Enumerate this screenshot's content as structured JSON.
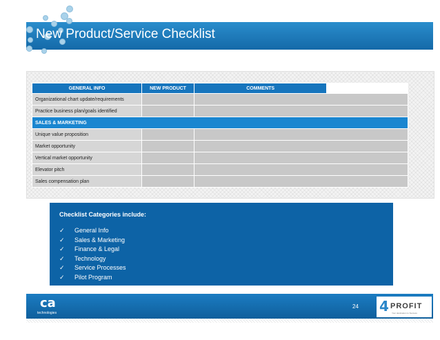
{
  "title": "New Product/Service Checklist",
  "table": {
    "headers": [
      "GENERAL INFO",
      "NEW PRODUCT",
      "COMMENTS"
    ],
    "rows": [
      {
        "type": "item",
        "label": "Organizational chart update/requirements"
      },
      {
        "type": "item",
        "label": "Practice business plan/goals identified"
      },
      {
        "type": "section",
        "label": "SALES & MARKETING"
      },
      {
        "type": "item",
        "label": "Unique value proposition"
      },
      {
        "type": "item",
        "label": "Market opportunity"
      },
      {
        "type": "item",
        "label": "Vertical market opportunity"
      },
      {
        "type": "item",
        "label": "Elevator pitch"
      },
      {
        "type": "item",
        "label": "Sales compensation plan"
      }
    ]
  },
  "categories": {
    "heading": "Checklist Categories include:",
    "check_glyph": "✓",
    "items": [
      "General Info",
      "Sales & Marketing",
      "Finance & Legal",
      "Technology",
      "Service Processes",
      "Pilot Program"
    ]
  },
  "footer": {
    "ca_logo_mark": "ca",
    "ca_logo_sub": "technologies",
    "page_number": "24",
    "profit_number": "4",
    "profit_word": "PROFIT",
    "profit_tagline": "Your destination to Success"
  },
  "colors": {
    "banner": "#1a78bb",
    "section_row": "#1a86d0",
    "category_box": "#0d63a6"
  }
}
